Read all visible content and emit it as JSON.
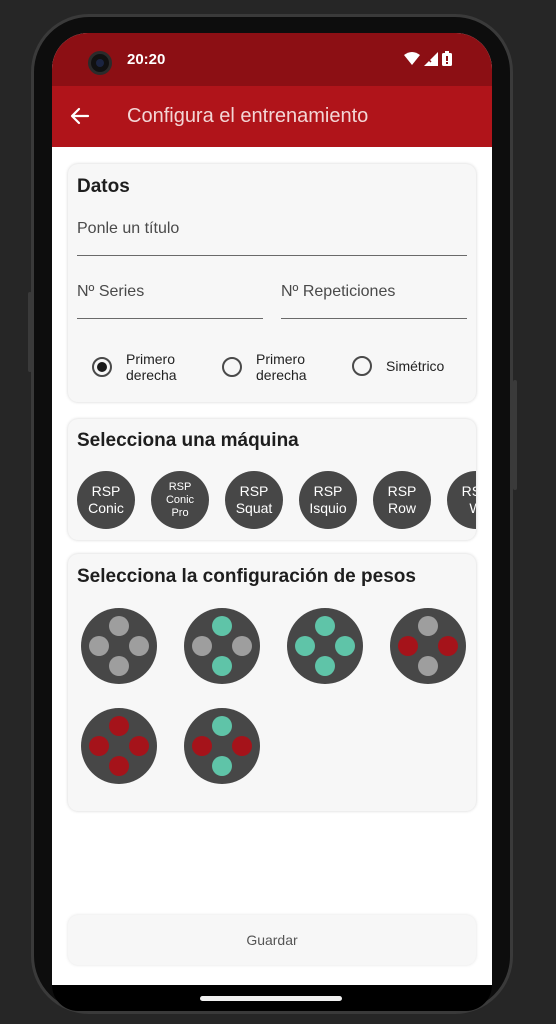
{
  "status": {
    "time": "20:20"
  },
  "app_bar": {
    "title": "Configura el entrenamiento"
  },
  "datos": {
    "heading": "Datos",
    "title_placeholder": "Ponle un título",
    "series_placeholder": "Nº Series",
    "reps_placeholder": "Nº Repeticiones",
    "radios": [
      {
        "label_line1": "Primero",
        "label_line2": "derecha",
        "checked": true
      },
      {
        "label_line1": "Primero",
        "label_line2": "derecha",
        "checked": false
      },
      {
        "label_line1": "Simétrico",
        "label_line2": "",
        "checked": false
      }
    ]
  },
  "machines": {
    "heading": "Selecciona una máquina",
    "items": [
      {
        "line1": "RSP",
        "line2": "Conic",
        "line3": ""
      },
      {
        "line1": "RSP",
        "line2": "Conic",
        "line3": "Pro"
      },
      {
        "line1": "RSP",
        "line2": "Squat",
        "line3": ""
      },
      {
        "line1": "RSP",
        "line2": "Isquio",
        "line3": ""
      },
      {
        "line1": "RSP",
        "line2": "Row",
        "line3": ""
      },
      {
        "line1": "RSP",
        "line2": "W",
        "line3": ""
      }
    ]
  },
  "weights": {
    "heading": "Selecciona la configuración de pesos",
    "configs": [
      [
        "gray",
        "gray",
        "gray",
        "gray"
      ],
      [
        "teal",
        "gray",
        "gray",
        "teal"
      ],
      [
        "teal",
        "teal",
        "teal",
        "teal"
      ],
      [
        "gray",
        "red",
        "red",
        "gray"
      ],
      [
        "red",
        "red",
        "red",
        "red"
      ],
      [
        "teal",
        "red",
        "red",
        "teal"
      ]
    ]
  },
  "save_label": "Guardar",
  "colors": {
    "status_bar": "#8c0f14",
    "app_bar": "#b0141a",
    "teal": "#5fc4a8",
    "red": "#a5131a",
    "gray": "#9e9e9e"
  }
}
